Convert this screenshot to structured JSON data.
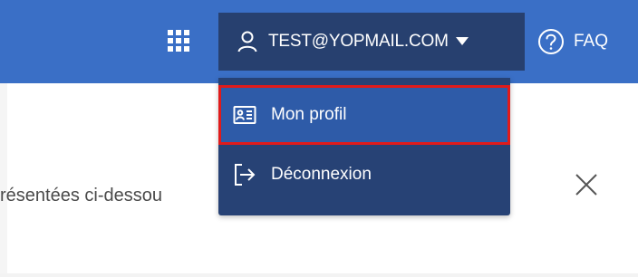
{
  "header": {
    "user_email": "TEST@YOPMAIL.COM",
    "faq_label": "FAQ",
    "icons": {
      "apps": "grid-icon",
      "user": "user-icon",
      "caret": "caret-down-icon",
      "help": "help-circle-icon"
    },
    "colors": {
      "bar": "#3a6fc6",
      "user_button": "#27406f"
    }
  },
  "dropdown": {
    "items": [
      {
        "label": "Mon profil",
        "icon": "id-card-icon",
        "highlighted": true
      },
      {
        "label": "Déconnexion",
        "icon": "logout-icon",
        "highlighted": false
      }
    ],
    "colors": {
      "background": "#274275",
      "highlight": "#2e5ba8",
      "highlight_border": "#e01b1b"
    }
  },
  "main": {
    "text": "résentées ci-dessou",
    "close_icon": "close-icon"
  }
}
